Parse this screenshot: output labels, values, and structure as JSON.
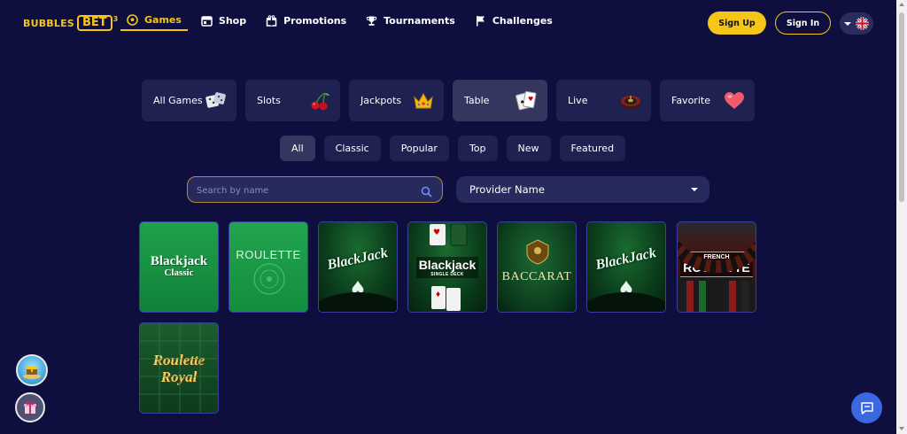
{
  "brand": {
    "name_part1": "BUBBLES",
    "name_part2": "BET",
    "name_sup": "3"
  },
  "nav": {
    "items": [
      {
        "label": "Games",
        "icon": "soccer-ball-icon",
        "active": true
      },
      {
        "label": "Shop",
        "icon": "shop-icon",
        "active": false
      },
      {
        "label": "Promotions",
        "icon": "gift-box-icon",
        "active": false
      },
      {
        "label": "Tournaments",
        "icon": "trophy-icon",
        "active": false
      },
      {
        "label": "Challenges",
        "icon": "flag-icon",
        "active": false
      }
    ]
  },
  "auth": {
    "signup_label": "Sign Up",
    "signin_label": "Sign In"
  },
  "language": {
    "icon": "uk-flag-icon"
  },
  "categories": [
    {
      "label": "All Games",
      "icon": "dice-icon",
      "active": false
    },
    {
      "label": "Slots",
      "icon": "cherries-icon",
      "active": false
    },
    {
      "label": "Jackpots",
      "icon": "crown-icon",
      "active": false
    },
    {
      "label": "Table",
      "icon": "cards-icon",
      "active": true
    },
    {
      "label": "Live",
      "icon": "roulette-wheel-icon",
      "active": false
    },
    {
      "label": "Favorite",
      "icon": "heart-icon",
      "active": false
    }
  ],
  "filters": [
    {
      "label": "All",
      "active": true
    },
    {
      "label": "Classic",
      "active": false
    },
    {
      "label": "Popular",
      "active": false
    },
    {
      "label": "Top",
      "active": false
    },
    {
      "label": "New",
      "active": false
    },
    {
      "label": "Featured",
      "active": false
    }
  ],
  "search": {
    "placeholder": "Search by name",
    "value": ""
  },
  "provider": {
    "label": "Provider Name"
  },
  "games": [
    {
      "title": "Blackjack",
      "subtitle": "Classic"
    },
    {
      "title": "ROULETTE",
      "subtitle": ""
    },
    {
      "title": "BlackJack",
      "subtitle": ""
    },
    {
      "title": "Blackjack",
      "subtitle": "SINGLE DECK"
    },
    {
      "title": "BACCARAT",
      "subtitle": ""
    },
    {
      "title": "BlackJack",
      "subtitle": ""
    },
    {
      "title": "ROULETTE",
      "subtitle": "FRENCH"
    },
    {
      "title": "Roulette Royal",
      "subtitle": ""
    }
  ],
  "colors": {
    "background": "#0e0f3f",
    "accent": "#f5c518",
    "panel": "#1f2151",
    "panel_active": "#34365f",
    "chat_button": "#3b67e0"
  }
}
